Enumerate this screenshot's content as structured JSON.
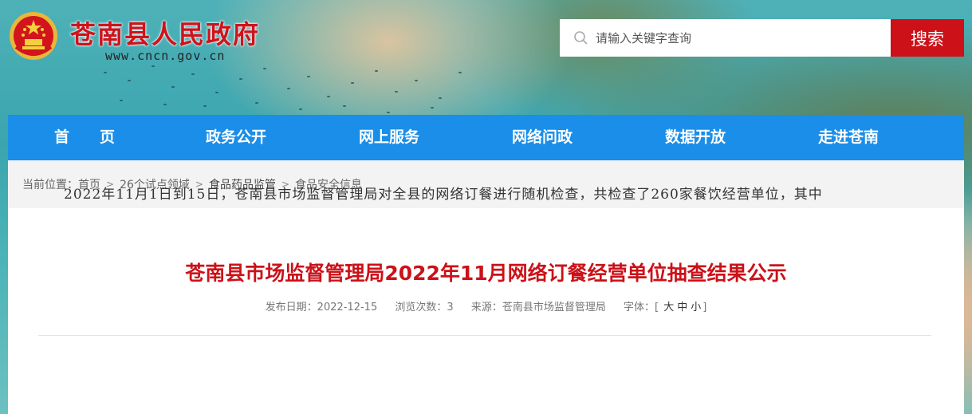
{
  "header": {
    "site_title": "苍南县人民政府",
    "domain": "www.cncn.gov.cn",
    "emblem_icon": "national-emblem-icon"
  },
  "search": {
    "placeholder": "请输入关键字查询",
    "button_label": "搜索",
    "icon": "search-icon"
  },
  "nav": {
    "items": [
      {
        "label": "首　　页"
      },
      {
        "label": "政务公开"
      },
      {
        "label": "网上服务"
      },
      {
        "label": "网络问政"
      },
      {
        "label": "数据开放"
      },
      {
        "label": "走进苍南"
      }
    ]
  },
  "breadcrumb": {
    "prefix": "当前位置：",
    "items": [
      "首页",
      "26个试点领域",
      "食品药品监管",
      "食品安全信息"
    ],
    "separator": ">"
  },
  "article": {
    "title": "苍南县市场监督管理局2022年11月网络订餐经营单位抽查结果公示",
    "publish_date_label": "发布日期：",
    "publish_date": "2022-12-15",
    "views_label": "浏览次数：",
    "views": "3",
    "source_label": "来源：",
    "source": "苍南县市场监督管理局",
    "font_size_label": "字体：[",
    "font_sizes": [
      "大",
      "中",
      "小"
    ],
    "font_size_close": "]",
    "body_first_line": "2022年11月1日到15日，苍南县市场监督管理局对全县的网络订餐进行随机检查，共检查了260家餐饮经营单位，其中"
  },
  "colors": {
    "brand_red": "#cc1118",
    "nav_blue": "#1a8ee8"
  }
}
